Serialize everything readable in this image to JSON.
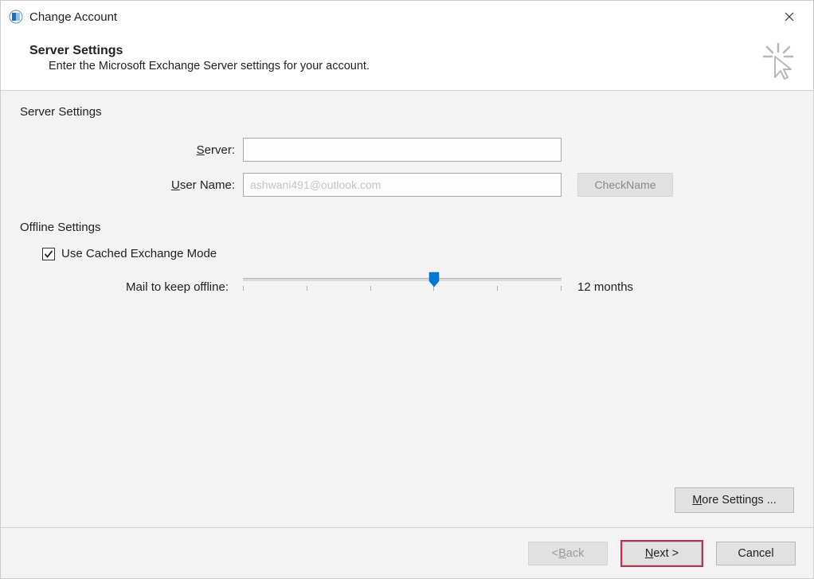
{
  "window": {
    "title": "Change Account"
  },
  "header": {
    "title": "Server Settings",
    "subtitle": "Enter the Microsoft Exchange Server settings for your account."
  },
  "server_settings": {
    "group_label": "Server Settings",
    "server_label_pre": "S",
    "server_label_post": "erver:",
    "server_value": "",
    "user_label_pre": "U",
    "user_label_post": "ser Name:",
    "user_value": "ashwani491@outlook.com",
    "check_name_pre": "Chec",
    "check_name_ul": "k",
    "check_name_post": " Name"
  },
  "offline_settings": {
    "group_label": "Offline Settings",
    "cached_checked": true,
    "cached_label_pre": "Use ",
    "cached_label_ul": "C",
    "cached_label_post": "ached Exchange Mode",
    "slider_label": "Mail to keep offline:",
    "slider_value_label": "12 months",
    "slider_position_pct": 60,
    "slider_ticks": 6
  },
  "more_settings": {
    "pre": "",
    "ul": "M",
    "post": "ore Settings ..."
  },
  "footer": {
    "back_pre": "< ",
    "back_ul": "B",
    "back_post": "ack",
    "next_ul": "N",
    "next_post": "ext >",
    "cancel": "Cancel"
  }
}
